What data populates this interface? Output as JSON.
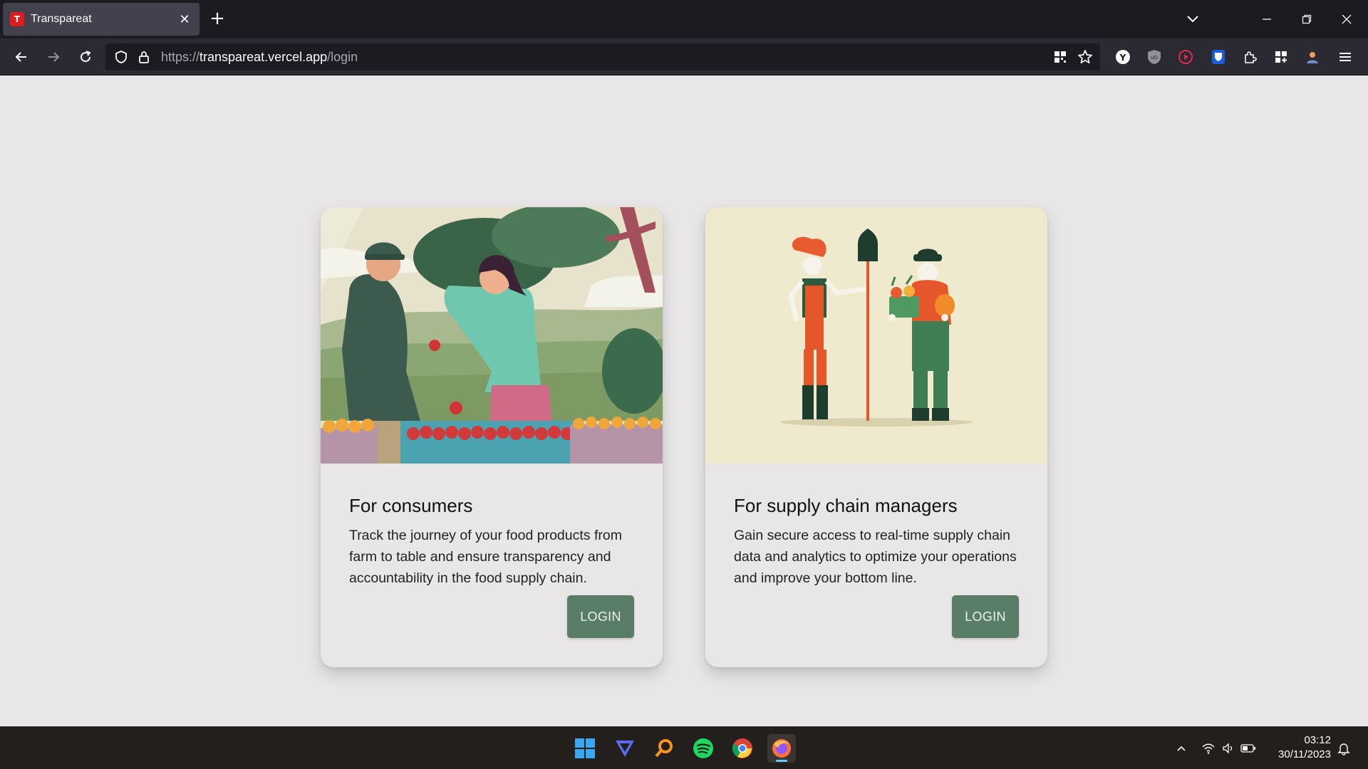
{
  "browser": {
    "tab_title": "Transpareat",
    "tab_favicon_letter": "T",
    "url_prefix": "https://",
    "url_host": "transpareat.vercel.app",
    "url_path": "/login"
  },
  "cards": [
    {
      "title": "For consumers",
      "body": "Track the journey of your food products from farm to table and ensure transparency and accountability in the food supply chain.",
      "button": "LOGIN"
    },
    {
      "title": "For supply chain managers",
      "body": "Gain secure access to real-time supply chain data and analytics to optimize your operations and improve your bottom line.",
      "button": "LOGIN"
    }
  ],
  "taskbar": {
    "time": "03:12",
    "date": "30/11/2023"
  },
  "colors": {
    "page_bg": "#e8e6e6",
    "button_bg": "#5a7d68",
    "browser_dark": "#1c1b22"
  }
}
